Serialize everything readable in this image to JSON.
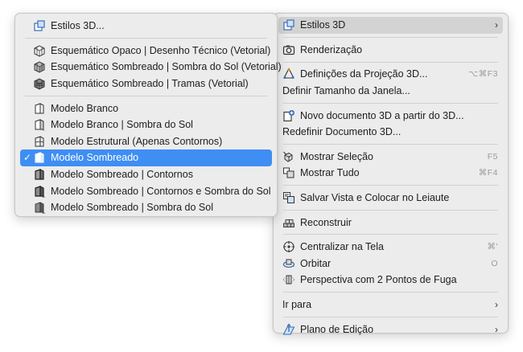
{
  "main_menu": {
    "items": [
      {
        "label": "Estilos 3D",
        "has_submenu": true,
        "icon": "estilos-3d-icon"
      },
      {
        "label": "Renderização",
        "icon": "camera-icon"
      },
      {
        "label": "Definições da Projeção 3D...",
        "shortcut": "⌥⌘F3",
        "icon": "projection-icon"
      },
      {
        "label": "Definir Tamanho da Janela..."
      },
      {
        "label": "Novo documento 3D a partir do 3D...",
        "icon": "new-document-icon"
      },
      {
        "label": "Redefinir Documento 3D..."
      },
      {
        "label": "Mostrar Seleção",
        "shortcut": "F5",
        "icon": "show-selection-icon"
      },
      {
        "label": "Mostrar Tudo",
        "shortcut": "⌘F4",
        "icon": "show-all-icon"
      },
      {
        "label": "Salvar Vista e Colocar no Leiaute",
        "icon": "save-view-icon"
      },
      {
        "label": "Reconstruir",
        "icon": "rebuild-icon"
      },
      {
        "label": "Centralizar na Tela",
        "shortcut": "⌘'",
        "icon": "center-icon"
      },
      {
        "label": "Orbitar",
        "shortcut": "O",
        "icon": "orbit-icon"
      },
      {
        "label": "Perspectiva com 2 Pontos de Fuga",
        "icon": "two-point-perspective-icon"
      },
      {
        "label": "Ir para",
        "has_submenu": true
      },
      {
        "label": "Plano de Edição",
        "has_submenu": true,
        "icon": "editing-plane-icon"
      }
    ]
  },
  "sub_menu": {
    "items": [
      {
        "label": "Estilos 3D...",
        "icon": "estilos-3d-icon"
      },
      {
        "label": "Esquemático Opaco | Desenho Técnico (Vetorial)",
        "icon": "schematic-opaque-icon"
      },
      {
        "label": "Esquemático Sombreado  | Sombra do Sol (Vetorial)",
        "icon": "schematic-shaded-sun-icon"
      },
      {
        "label": "Esquemático Sombreado | Tramas (Vetorial)",
        "icon": "schematic-shaded-hatch-icon"
      },
      {
        "label": "Modelo Branco",
        "icon": "white-model-icon"
      },
      {
        "label": "Modelo Branco | Sombra do Sol",
        "icon": "white-model-sun-icon"
      },
      {
        "label": "Modelo Estrutural (Apenas Contornos)",
        "icon": "structural-model-icon"
      },
      {
        "label": "Modelo Sombreado",
        "icon": "shaded-model-icon",
        "checked": true,
        "check_mark": "✓"
      },
      {
        "label": "Modelo Sombreado | Contornos",
        "icon": "shaded-contours-icon"
      },
      {
        "label": "Modelo Sombreado | Contornos e Sombra do Sol",
        "icon": "shaded-contours-sun-icon"
      },
      {
        "label": "Modelo Sombreado | Sombra do Sol",
        "icon": "shaded-sun-icon"
      }
    ]
  },
  "colors": {
    "menu_bg": "#ececec",
    "hover": "#d3d3d3",
    "selected": "#3f8ef4",
    "shortcut": "#9a9a9a"
  },
  "arrow_glyph": "›"
}
